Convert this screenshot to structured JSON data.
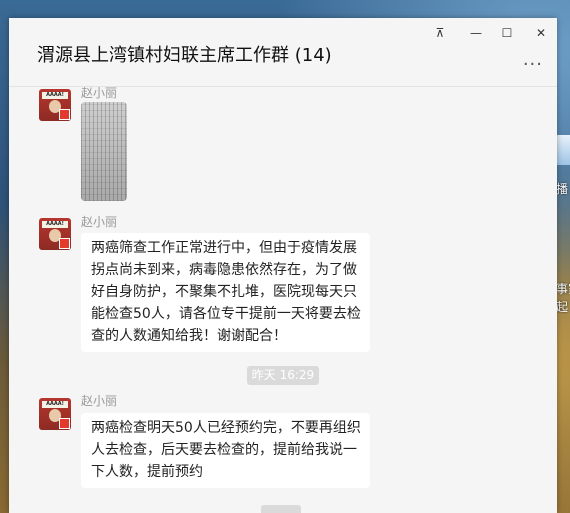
{
  "window": {
    "title": "渭源县上湾镇村妇联主席工作群 (14)",
    "controls": {
      "pin": "⊼",
      "minimize": "—",
      "maximize": "☐",
      "close": "✕"
    },
    "more": "···"
  },
  "messages": [
    {
      "sender": "赵小丽",
      "type": "image"
    },
    {
      "sender": "赵小丽",
      "type": "text",
      "lines": [
        "两癌筛查工作正常进行中，但由于疫情发展",
        "拐点尚未到来，病毒隐患依然存在，为了做",
        "好自身防护，不聚集不扎堆，医院现每天只",
        "能检查50人，请各位专干提前一天将要去检",
        "查的人数通知给我！谢谢配合！"
      ]
    },
    {
      "type": "timestamp",
      "text": "昨天 16:29"
    },
    {
      "sender": "赵小丽",
      "type": "text",
      "lines": [
        "两癌检查明天50人已经预约完，不要再组织",
        "人去检查，后天要去检查的，提前给我说一",
        "下人数，提前预约"
      ]
    }
  ],
  "avatar_banner": "AAAA!",
  "desktop": {
    "label_1": "播",
    "label_2": "事家",
    "label_3": "起"
  },
  "colors": {
    "window_bg": "#f5f5f5",
    "bubble_bg": "#ffffff",
    "timestamp_bg": "#dadada"
  }
}
